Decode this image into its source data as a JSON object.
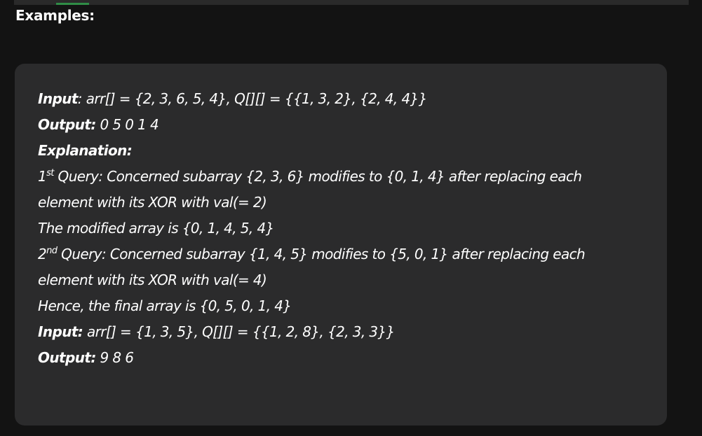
{
  "section": {
    "title": "Examples:"
  },
  "example": {
    "ex1_input_label": "Input",
    "ex1_input_text": ": arr[] = {2, 3, 6, 5, 4}, Q[][] = {{1, 3, 2}, {2, 4, 4}}",
    "ex1_output_label": "Output:",
    "ex1_output_text": " 0 5 0 1 4",
    "explanation_label": "Explanation:",
    "q1_num": "1",
    "q1_sup": "st",
    "q1_text": " Query: Concerned subarray {2, 3, 6} modifies to {0, 1, 4} after replacing each",
    "q1_cont": "element with its XOR with val(= 2)",
    "q1_result": "The modified array is {0, 1, 4, 5, 4}",
    "q2_num": "2",
    "q2_sup": "nd",
    "q2_text": " Query: Concerned subarray {1, 4, 5} modifies to {5, 0, 1} after replacing each",
    "q2_cont": "element with its XOR with val(= 4)",
    "final_text": "Hence, the final array is {0, 5, 0, 1, 4}",
    "ex2_input_label": "Input:",
    "ex2_input_text": " arr[] = {1, 3, 5}, Q[][] = {{1, 2, 8}, {2, 3, 3}}",
    "ex2_output_label": "Output:",
    "ex2_output_text": " 9 8 6"
  },
  "colors": {
    "page_bg": "#131313",
    "box_bg": "#2b2b2c",
    "accent": "#2f8d46",
    "text": "#ffffff"
  }
}
